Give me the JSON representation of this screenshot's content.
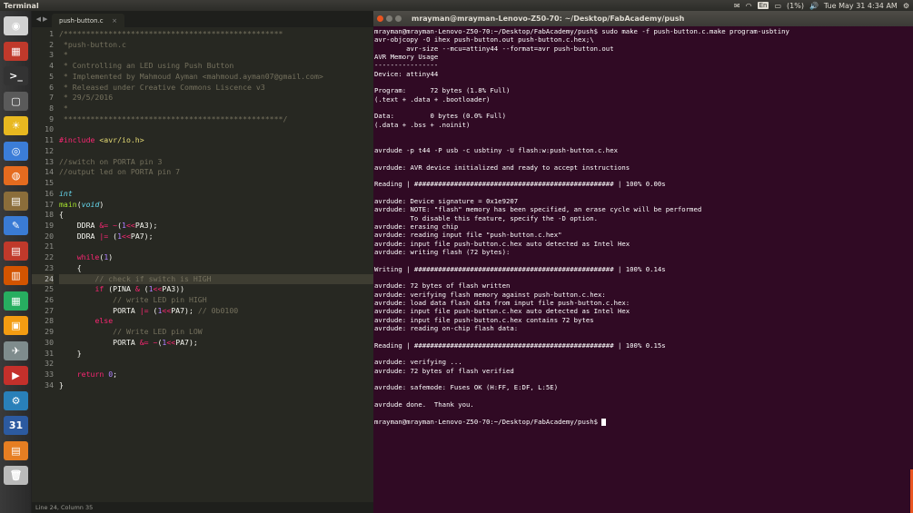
{
  "topbar": {
    "app_title": "Terminal",
    "keyboard": "En",
    "battery": "(1%)",
    "clock": "Tue May 31  4:34 AM"
  },
  "launcher": {
    "icons": [
      "ubuntu-dash",
      "software",
      "terminal",
      "workspace",
      "lightbulb",
      "chrome",
      "firefox",
      "files",
      "text-editor",
      "office",
      "presentation",
      "calc",
      "image",
      "tools",
      "youtube",
      "settings",
      "calendar",
      "archive",
      "trash"
    ]
  },
  "editor": {
    "tab_label": "push-button.c",
    "tab_close": "×",
    "status": "Line 24, Column 35",
    "lines": [
      "/*************************************************",
      " *push-button.c",
      " *",
      " * Controlling an LED using Push Button",
      " * Implemented by Mahmoud Ayman <mahmoud.ayman07@gmail.com>",
      " * Released under Creative Commons Liscence v3",
      " * 29/5/2016",
      " *",
      " *************************************************/",
      "",
      "#include <avr/io.h>",
      "",
      "//switch on PORTA pin 3",
      "//output led on PORTA pin 7",
      "",
      "int",
      "main(void)",
      "{",
      "    DDRA &= ~(1<<PA3);",
      "    DDRA |= (1<<PA7);",
      "",
      "    while(1)",
      "    {",
      "        // check if switch is HIGH",
      "        if (PINA & (1<<PA3))",
      "            // write LED pin HIGH",
      "            PORTA |= (1<<PA7); // 0b0100",
      "        else",
      "            // Write LED pin LOW",
      "            PORTA &= ~(1<<PA7);",
      "    }",
      "",
      "    return 0;",
      "}"
    ]
  },
  "terminal": {
    "title": "mrayman@mrayman-Lenovo-Z50-70: ~/Desktop/FabAcademy/push",
    "prompt": "mrayman@mrayman-Lenovo-Z50-70:~/Desktop/FabAcademy/push$ ",
    "lines": [
      "mrayman@mrayman-Lenovo-Z50-70:~/Desktop/FabAcademy/push$ sudo make -f push-button.c.make program-usbtiny",
      "avr-objcopy -O ihex push-button.out push-button.c.hex;\\",
      "        avr-size --mcu=attiny44 --format=avr push-button.out",
      "AVR Memory Usage",
      "----------------",
      "Device: attiny44",
      "",
      "Program:      72 bytes (1.8% Full)",
      "(.text + .data + .bootloader)",
      "",
      "Data:         0 bytes (0.0% Full)",
      "(.data + .bss + .noinit)",
      "",
      "",
      "avrdude -p t44 -P usb -c usbtiny -U flash:w:push-button.c.hex",
      "",
      "avrdude: AVR device initialized and ready to accept instructions",
      "",
      "Reading | ################################################## | 100% 0.00s",
      "",
      "avrdude: Device signature = 0x1e9207",
      "avrdude: NOTE: \"flash\" memory has been specified, an erase cycle will be performed",
      "         To disable this feature, specify the -D option.",
      "avrdude: erasing chip",
      "avrdude: reading input file \"push-button.c.hex\"",
      "avrdude: input file push-button.c.hex auto detected as Intel Hex",
      "avrdude: writing flash (72 bytes):",
      "",
      "Writing | ################################################## | 100% 0.14s",
      "",
      "avrdude: 72 bytes of flash written",
      "avrdude: verifying flash memory against push-button.c.hex:",
      "avrdude: load data flash data from input file push-button.c.hex:",
      "avrdude: input file push-button.c.hex auto detected as Intel Hex",
      "avrdude: input file push-button.c.hex contains 72 bytes",
      "avrdude: reading on-chip flash data:",
      "",
      "Reading | ################################################## | 100% 0.15s",
      "",
      "avrdude: verifying ...",
      "avrdude: 72 bytes of flash verified",
      "",
      "avrdude: safemode: Fuses OK (H:FF, E:DF, L:5E)",
      "",
      "avrdude done.  Thank you.",
      ""
    ]
  },
  "colors": {
    "terminal_bg": "#300a24",
    "editor_bg": "#272822",
    "accent": "#e95420"
  }
}
